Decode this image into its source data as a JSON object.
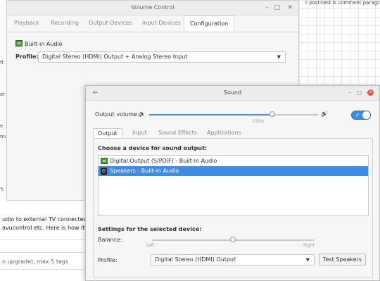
{
  "background": {
    "top_snippet": "r post-test is comment paragraphs",
    "lines": [
      "udio to external TV connected v",
      "avucontrol etc. Here is how it lo"
    ],
    "tags_text": "n upgrade), max 5 tags",
    "fragments": [
      "ft",
      "er",
      "e",
      "ma",
      "'t"
    ]
  },
  "volume_control": {
    "title": "Volume Control",
    "tabs": [
      "Playback",
      "Recording",
      "Output Devices",
      "Input Devices",
      "Configuration"
    ],
    "active_tab": "Configuration",
    "card_name": "Built-in Audio",
    "profile_label": "Profile:",
    "profile_value": "Digital Stereo (HDMI) Output + Analog Stereo Input"
  },
  "sound": {
    "title": "Sound",
    "output_volume_label": "Output volume:",
    "volume_percent_label": "100%",
    "volume_fraction": 0.73,
    "output_enabled": true,
    "tabs": [
      "Output",
      "Input",
      "Sound Effects",
      "Applications"
    ],
    "active_tab": "Output",
    "choose_device_label": "Choose a device for sound output:",
    "devices": [
      {
        "name": "Digital Output (S/PDIF) - Built-in Audio",
        "icon": "audio-card-icon",
        "selected": false
      },
      {
        "name": "Speakers - Built-in Audio",
        "icon": "speaker-icon",
        "selected": true
      }
    ],
    "settings_label": "Settings for the selected device:",
    "balance_label": "Balance:",
    "balance_left": "Left",
    "balance_right": "Right",
    "balance_fraction": 0.5,
    "profile_label": "Profile:",
    "profile_value": "Digital Stereo (HDMI) Output",
    "test_button": "Test Speakers"
  },
  "colors": {
    "accent": "#3f8ae2",
    "close": "#e0573e"
  }
}
